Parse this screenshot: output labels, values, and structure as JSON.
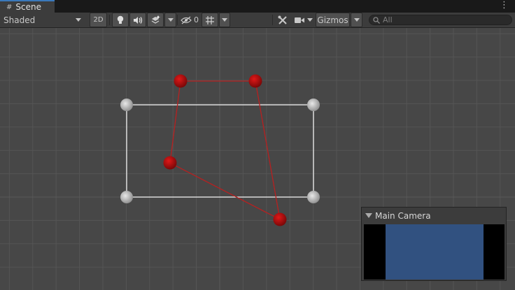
{
  "tab": {
    "label": "Scene",
    "icon": "grid-hash-icon"
  },
  "toolbar": {
    "shading_mode": "Shaded",
    "mode_2d_label": "2D",
    "hidden_count": "0",
    "gizmos_label": "Gizmos",
    "search_placeholder": "All"
  },
  "camera_preview": {
    "title": "Main Camera"
  },
  "colors": {
    "viewport_bg": "#474747",
    "grid": "#555555",
    "rect": "#ffffff",
    "path": "#b82020",
    "handle_red": "#c01010",
    "handle_gray": "#c8c8c8",
    "camera_bg": "#315180"
  }
}
